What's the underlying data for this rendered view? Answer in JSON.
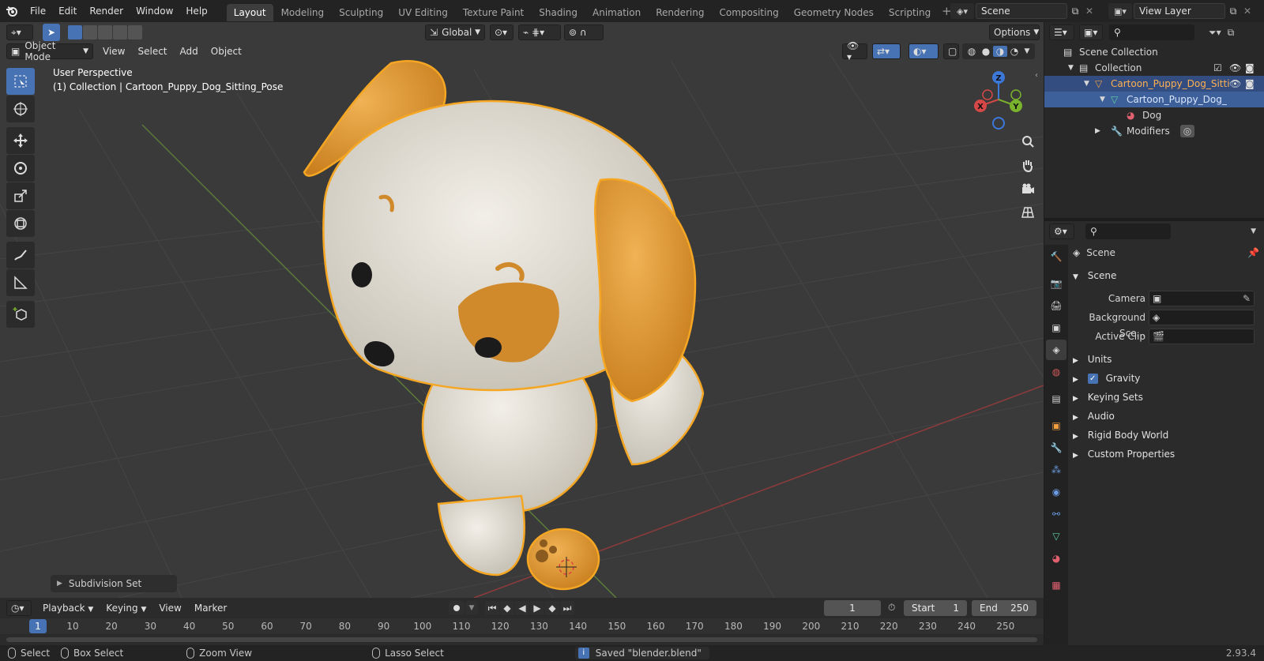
{
  "app": {
    "version": "2.93.4"
  },
  "menubar": {
    "items": [
      "File",
      "Edit",
      "Render",
      "Window",
      "Help"
    ],
    "workspaces": [
      "Layout",
      "Modeling",
      "Sculpting",
      "UV Editing",
      "Texture Paint",
      "Shading",
      "Animation",
      "Rendering",
      "Compositing",
      "Geometry Nodes",
      "Scripting"
    ],
    "active_workspace": "Layout",
    "scene_name": "Scene",
    "view_layer": "View Layer"
  },
  "viewport": {
    "mode": "Object Mode",
    "menus": [
      "View",
      "Select",
      "Add",
      "Object"
    ],
    "orientation": "Global",
    "options_label": "Options",
    "perspective_label": "User Perspective",
    "collection_label": "(1) Collection | Cartoon_Puppy_Dog_Sitting_Pose",
    "redo_panel": "Subdivision Set",
    "gizmo": {
      "x": "X",
      "y": "Y",
      "z": "Z"
    }
  },
  "outliner": {
    "items": [
      {
        "label": "Scene Collection",
        "icon": "collection-icon"
      },
      {
        "label": "Collection",
        "icon": "collection-icon"
      },
      {
        "label": "Cartoon_Puppy_Dog_Sitti",
        "icon": "mesh-object-icon"
      },
      {
        "label": "Cartoon_Puppy_Dog_",
        "icon": "mesh-data-icon"
      },
      {
        "label": "Dog",
        "icon": "material-icon"
      },
      {
        "label": "Modifiers",
        "icon": "wrench-icon"
      }
    ]
  },
  "properties": {
    "context": "Scene",
    "panel_title": "Scene",
    "fields": [
      {
        "label": "Camera",
        "value": ""
      },
      {
        "label": "Background Sce...",
        "value": ""
      },
      {
        "label": "Active Clip",
        "value": ""
      }
    ],
    "collapsed_panels": [
      "Units",
      "Gravity",
      "Keying Sets",
      "Audio",
      "Rigid Body World",
      "Custom Properties"
    ],
    "gravity_checked": true
  },
  "timeline": {
    "menus": [
      "Playback",
      "Keying",
      "View",
      "Marker"
    ],
    "current_frame": "1",
    "start_label": "Start",
    "start_value": "1",
    "end_label": "End",
    "end_value": "250",
    "ruler": [
      "1",
      "10",
      "20",
      "30",
      "40",
      "50",
      "60",
      "70",
      "80",
      "90",
      "100",
      "110",
      "120",
      "130",
      "140",
      "150",
      "160",
      "170",
      "180",
      "190",
      "200",
      "210",
      "220",
      "230",
      "240",
      "250"
    ]
  },
  "statusbar": {
    "select": "Select",
    "box_select": "Box Select",
    "zoom_view": "Zoom View",
    "lasso_select": "Lasso Select",
    "message": "Saved \"blender.blend\""
  },
  "colors": {
    "accent": "#4772b3",
    "selection_outline": "#f5a623",
    "x_axis": "#d64848",
    "y_axis": "#7ab32c",
    "z_axis": "#3c78d8"
  }
}
